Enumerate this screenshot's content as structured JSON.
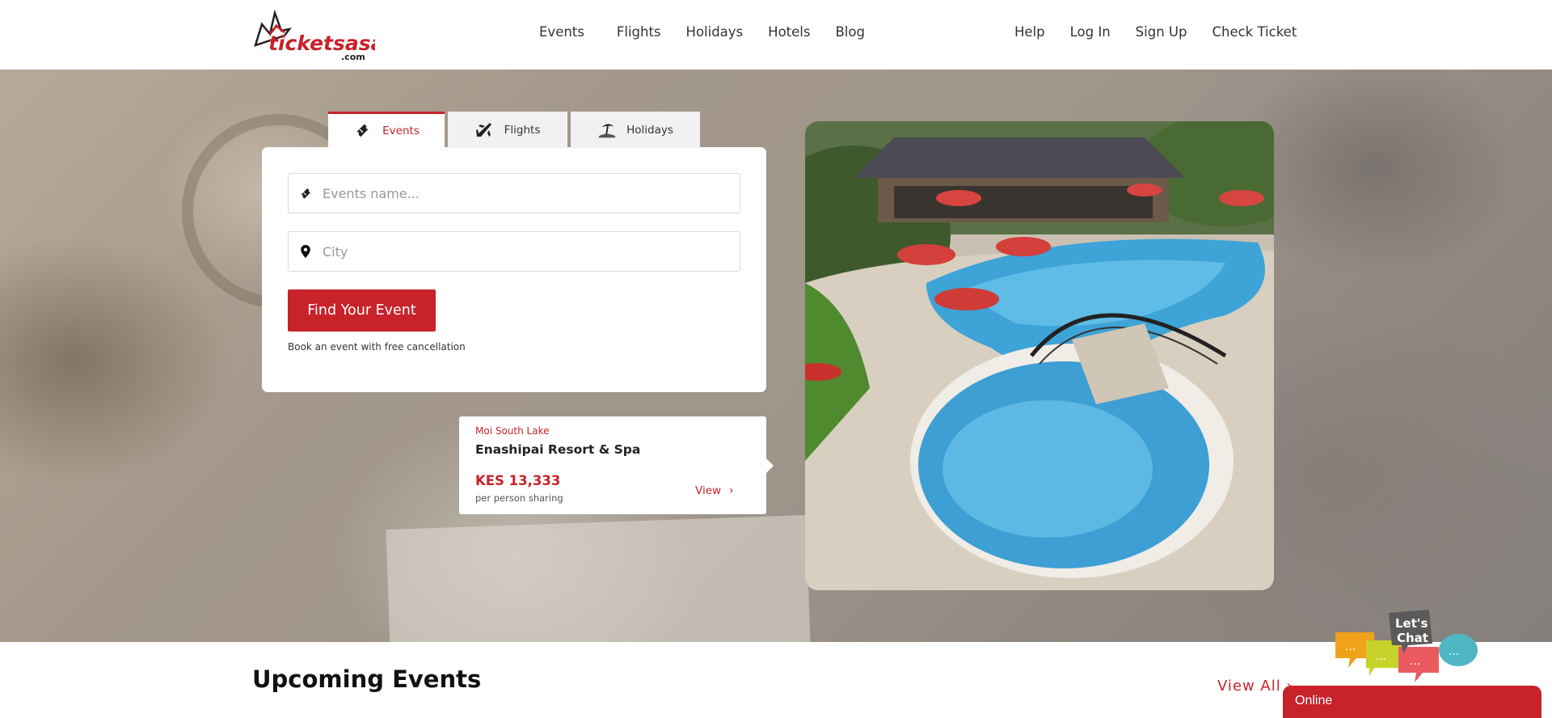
{
  "brand": {
    "logo_text": "ticketsasa",
    "logo_sub": ".com",
    "accent": "#c8222a"
  },
  "nav": {
    "main": [
      "Events",
      "Flights",
      "Holidays",
      "Hotels",
      "Blog"
    ],
    "right": [
      "Help",
      "Log In",
      "Sign Up",
      "Check Ticket"
    ]
  },
  "search": {
    "tabs": [
      {
        "label": "Events",
        "icon": "ticket-icon",
        "active": true
      },
      {
        "label": "Flights",
        "icon": "airplane-icon",
        "active": false
      },
      {
        "label": "Holidays",
        "icon": "beach-icon",
        "active": false
      }
    ],
    "event_placeholder": "Events name...",
    "city_placeholder": "City",
    "button_label": "Find Your Event",
    "note": "Book an event with free cancellation"
  },
  "promo": {
    "location": "Moi South Lake",
    "name": "Enashipai Resort & Spa",
    "price": "KES 13,333",
    "price_note": "per person sharing",
    "view_label": "View"
  },
  "upcoming": {
    "title": "Upcoming Events",
    "view_all": "View All"
  },
  "chat": {
    "badge": "Let's Chat",
    "status": "Online"
  }
}
